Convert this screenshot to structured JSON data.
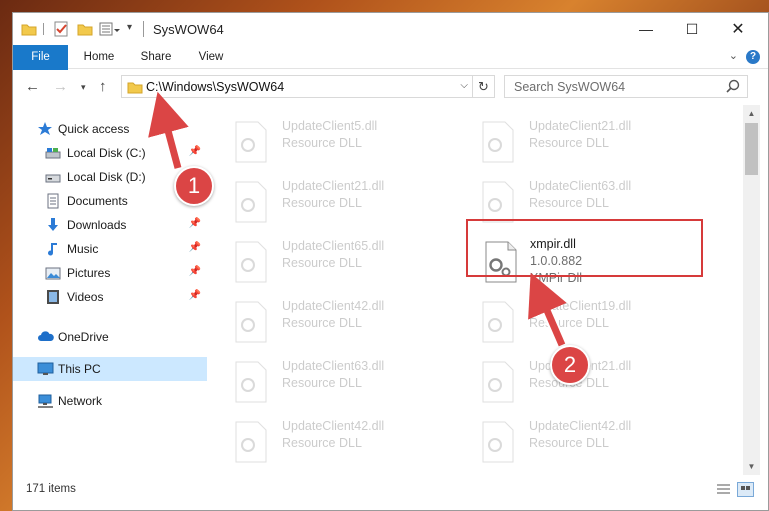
{
  "window": {
    "title": "SysWOW64"
  },
  "ribbon": {
    "tabs": [
      "File",
      "Home",
      "Share",
      "View"
    ]
  },
  "address": {
    "path": "C:\\Windows\\SysWOW64"
  },
  "search": {
    "placeholder": "Search SysWOW64"
  },
  "sidebar": {
    "items": [
      {
        "label": "Quick access",
        "icon": "star-icon",
        "pinned": false
      },
      {
        "label": "Local Disk (C:)",
        "icon": "drive-icon",
        "pinned": true
      },
      {
        "label": "Local Disk (D:)",
        "icon": "drive-icon",
        "pinned": false
      },
      {
        "label": "Documents",
        "icon": "documents-icon",
        "pinned": true
      },
      {
        "label": "Downloads",
        "icon": "download-icon",
        "pinned": true
      },
      {
        "label": "Music",
        "icon": "music-icon",
        "pinned": true
      },
      {
        "label": "Pictures",
        "icon": "pictures-icon",
        "pinned": true
      },
      {
        "label": "Videos",
        "icon": "videos-icon",
        "pinned": true
      },
      {
        "label": "OneDrive",
        "icon": "cloud-icon",
        "pinned": false
      },
      {
        "label": "This PC",
        "icon": "computer-icon",
        "pinned": false,
        "selected": true
      },
      {
        "label": "Network",
        "icon": "network-icon",
        "pinned": false
      }
    ]
  },
  "files": {
    "left": [
      {
        "name": "UpdateClient5.dll",
        "type": "Resource DLL"
      },
      {
        "name": "UpdateClient21.dll",
        "type": "Resource DLL"
      },
      {
        "name": "UpdateClient65.dll",
        "type": "Resource DLL"
      },
      {
        "name": "UpdateClient42.dll",
        "type": "Resource DLL"
      },
      {
        "name": "UpdateClient63.dll",
        "type": "Resource DLL"
      },
      {
        "name": "UpdateClient42.dll",
        "type": "Resource DLL"
      }
    ],
    "right": [
      {
        "name": "UpdateClient21.dll",
        "type": "Resource DLL"
      },
      {
        "name": "UpdateClient63.dll",
        "type": "Resource DLL"
      },
      {
        "name": "xmpir.dll",
        "version": "1.0.0.882",
        "type": "XMPir Dll",
        "highlighted": true
      },
      {
        "name": "UpdateClient19.dll",
        "type": "Resource DLL"
      },
      {
        "name": "UpdateClient21.dll",
        "type": "Resource DLL"
      },
      {
        "name": "UpdateClient42.dll",
        "type": "Resource DLL"
      }
    ]
  },
  "status": {
    "item_count": "171 items"
  },
  "annotations": {
    "step1": "1",
    "step2": "2",
    "color": "#db4545"
  }
}
